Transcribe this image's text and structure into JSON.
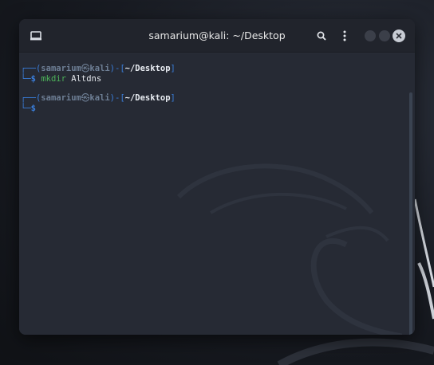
{
  "window": {
    "title": "samarium@kali: ~/Desktop"
  },
  "terminal": {
    "lines": [
      {
        "prompt": {
          "open": "┌──(",
          "user": "samarium",
          "at": "㉿",
          "host": "kali",
          "mid": ")-[",
          "path": "~/Desktop",
          "close": "]",
          "corner": "└─",
          "symbol": "$"
        },
        "command": "mkdir",
        "args": " Altdns"
      },
      {
        "prompt": {
          "open": "┌──(",
          "user": "samarium",
          "at": "㉿",
          "host": "kali",
          "mid": ")-[",
          "path": "~/Desktop",
          "close": "]",
          "corner": "└─",
          "symbol": "$"
        },
        "command": "",
        "args": ""
      }
    ]
  },
  "icons": {
    "terminal_icon": "terminal-icon",
    "search_icon": "search-icon",
    "menu_icon": "kebab-menu-icon",
    "close_icon": "close-icon"
  },
  "colors": {
    "prompt_frame": "#3a7edb",
    "command": "#4db35a",
    "background": "#262a34"
  }
}
